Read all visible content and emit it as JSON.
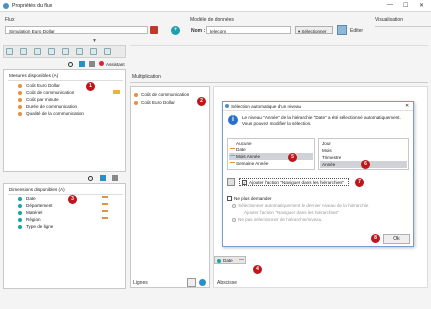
{
  "window": {
    "title": "Propriétés du flux",
    "minimize": "—",
    "maximize": "☐",
    "close": "✕"
  },
  "flux": {
    "label": "Flux",
    "name": "Simulation Euro Dollar"
  },
  "model": {
    "label": "Modèle de données",
    "name_label": "Nom :",
    "name_value": "telecom",
    "select_label": "▾ Sélectionner",
    "edit_label": "Editer"
  },
  "visualization": {
    "label": "Visualisation"
  },
  "toolbar": {
    "assistant_label": "Assistant"
  },
  "measures": {
    "header": "Mesures disponibles (A)",
    "items": [
      "Coût Euro Dollar",
      "Coût de communication",
      "Coût par minute",
      "Durée de communication",
      "Qualité de la communication"
    ]
  },
  "dimensions": {
    "header": "Dimensions disponibles (A)",
    "items": [
      "Date",
      "Département",
      "Matériel",
      "Région",
      "Type de ligne"
    ]
  },
  "multiplication": {
    "label": "Multiplication",
    "items": [
      "Coût de communication",
      "Coût Euro Dollar"
    ]
  },
  "lignes": {
    "label": "Lignes"
  },
  "abscisse": {
    "label": "Abscisse",
    "chip": "Date"
  },
  "dialog": {
    "title": "Sélection automatique d'un niveau",
    "message": "Le niveau \"Année\" de la hiérarchie \"Date\" a été sélectionné automatiquement. Vous pouvez modifier la sélection.",
    "left_list": [
      "Aucune",
      "Date",
      "Mois Année",
      "Semaine Année"
    ],
    "right_list": [
      "Jour",
      "Mois",
      "Trimestre",
      "Année"
    ],
    "checkbox_label": "Ajouter l'action \"Naviguer dans les hiérarchies\"",
    "no_ask_label": "Ne plus demander",
    "radio1": "Sélectionner automatiquement le dernier niveau de la hiérarchie.",
    "radio1_sub": "Ajouter l'action \"Naviguer dans les hiérarchies\"",
    "radio2": "Ne pas sélectionner de hiérarchie/niveau.",
    "ok_label": "Ok",
    "close": "✕"
  },
  "badges": [
    "1",
    "2",
    "3",
    "4",
    "5",
    "6",
    "7",
    "8"
  ],
  "colors": {
    "measure_dot": "#e8913a",
    "dim_dot": "#18a5a7",
    "badge": "#c0151b",
    "accent": "#1f9fb0"
  }
}
